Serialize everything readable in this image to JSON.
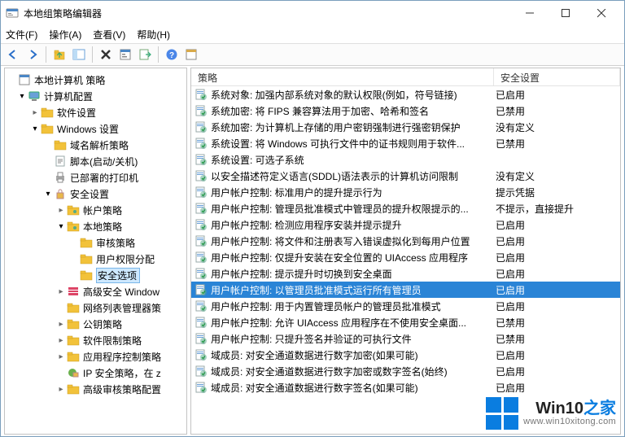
{
  "window": {
    "title": "本地组策略编辑器"
  },
  "menu": {
    "file": "文件(F)",
    "action": "操作(A)",
    "view": "查看(V)",
    "help": "帮助(H)"
  },
  "tree": {
    "root": "本地计算机 策略",
    "computer_config": "计算机配置",
    "software": "软件设置",
    "windows_settings": "Windows 设置",
    "dns_policy": "域名解析策略",
    "scripts": "脚本(启动/关机)",
    "printers": "已部署的打印机",
    "security_settings": "安全设置",
    "account_policy": "帐户策略",
    "local_policy": "本地策略",
    "audit_policy": "审核策略",
    "user_rights": "用户权限分配",
    "security_options": "安全选项",
    "adv_firewall": "高级安全 Window",
    "network_list": "网络列表管理器策",
    "public_key": "公钥策略",
    "software_restrict": "软件限制策略",
    "app_control": "应用程序控制策略",
    "ip_security": "IP 安全策略，在 z",
    "adv_audit": "高级审核策略配置"
  },
  "list": {
    "col_policy": "策略",
    "col_setting": "安全设置"
  },
  "rows": [
    {
      "policy": "系统对象: 加强内部系统对象的默认权限(例如，符号链接)",
      "setting": "已启用"
    },
    {
      "policy": "系统加密: 将 FIPS 兼容算法用于加密、哈希和签名",
      "setting": "已禁用"
    },
    {
      "policy": "系统加密: 为计算机上存储的用户密钥强制进行强密钥保护",
      "setting": "没有定义"
    },
    {
      "policy": "系统设置: 将 Windows 可执行文件中的证书规则用于软件...",
      "setting": "已禁用"
    },
    {
      "policy": "系统设置: 可选子系统",
      "setting": ""
    },
    {
      "policy": "以安全描述符定义语言(SDDL)语法表示的计算机访问限制",
      "setting": "没有定义"
    },
    {
      "policy": "用户帐户控制: 标准用户的提升提示行为",
      "setting": "提示凭据"
    },
    {
      "policy": "用户帐户控制: 管理员批准模式中管理员的提升权限提示的...",
      "setting": "不提示，直接提升"
    },
    {
      "policy": "用户帐户控制: 检测应用程序安装并提示提升",
      "setting": "已启用"
    },
    {
      "policy": "用户帐户控制: 将文件和注册表写入错误虚拟化到每用户位置",
      "setting": "已启用"
    },
    {
      "policy": "用户帐户控制: 仅提升安装在安全位置的 UIAccess 应用程序",
      "setting": "已启用"
    },
    {
      "policy": "用户帐户控制: 提示提升时切换到安全桌面",
      "setting": "已启用"
    },
    {
      "policy": "用户帐户控制: 以管理员批准模式运行所有管理员",
      "setting": "已启用",
      "selected": true
    },
    {
      "policy": "用户帐户控制: 用于内置管理员帐户的管理员批准模式",
      "setting": "已启用"
    },
    {
      "policy": "用户帐户控制: 允许 UIAccess 应用程序在不使用安全桌面...",
      "setting": "已禁用"
    },
    {
      "policy": "用户帐户控制: 只提升签名并验证的可执行文件",
      "setting": "已禁用"
    },
    {
      "policy": "域成员: 对安全通道数据进行数字加密(如果可能)",
      "setting": "已启用"
    },
    {
      "policy": "域成员: 对安全通道数据进行数字加密或数字签名(始终)",
      "setting": "已启用"
    },
    {
      "policy": "域成员: 对安全通道数据进行数字签名(如果可能)",
      "setting": "已启用"
    }
  ],
  "watermark": {
    "brand_a": "Win10",
    "brand_b": "之家",
    "url": "www.win10xitong.com"
  }
}
